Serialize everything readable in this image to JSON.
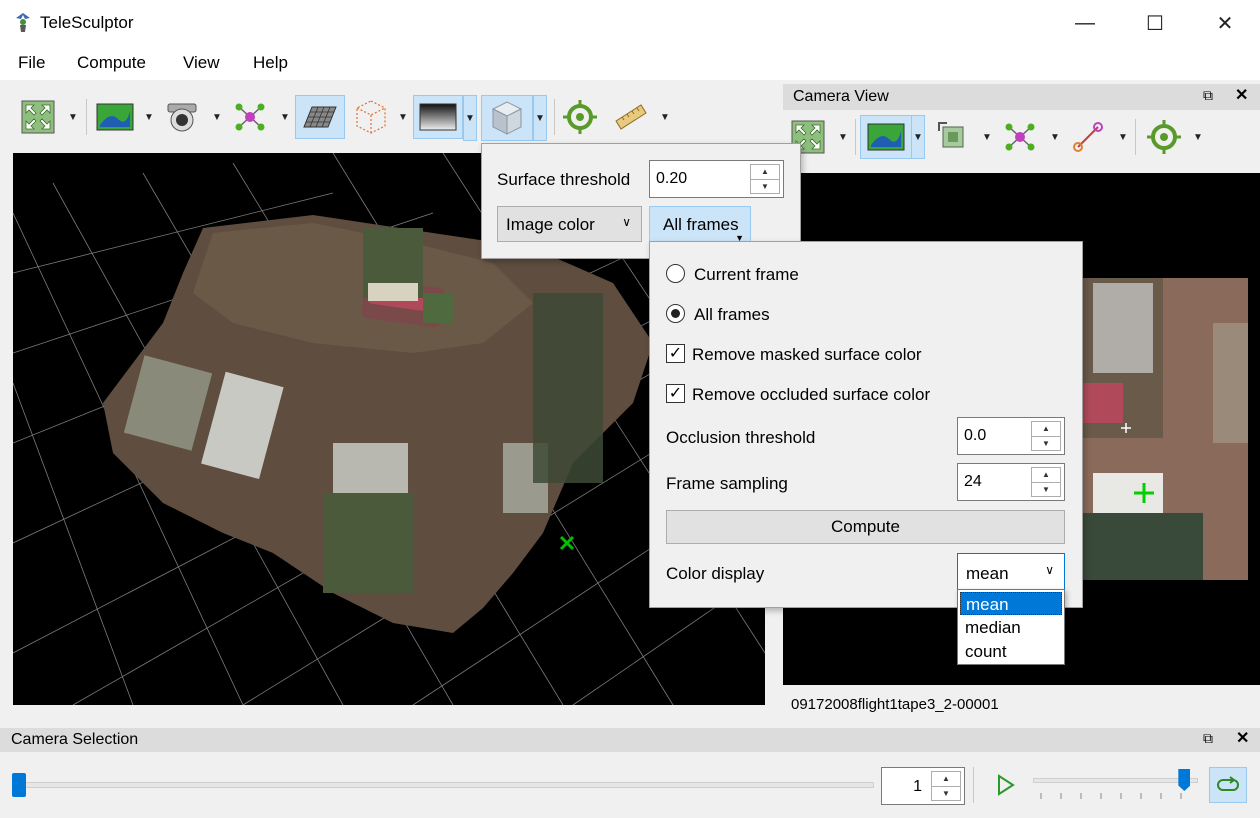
{
  "app": {
    "title": "TeleSculptor",
    "window_buttons": {
      "minimize": "—",
      "maximize": "☐",
      "close": "✕"
    }
  },
  "menu": [
    "File",
    "Compute",
    "View",
    "Help"
  ],
  "main_toolbar": {
    "buttons": [
      "reset-view-icon",
      "imagery-icon",
      "camera-icon",
      "landmarks-icon",
      "ground-plane-icon",
      "roi-box-icon",
      "depth-map-icon",
      "surface-icon",
      "world-point-icon",
      "ruler-icon"
    ],
    "active": [
      "ground-plane-icon",
      "depth-map-icon",
      "surface-icon"
    ]
  },
  "camera_view": {
    "title": "Camera View",
    "toolbar_buttons": [
      "reset-view-icon",
      "imagery-icon",
      "crop-icon",
      "landmarks-icon",
      "residuals-icon",
      "world-point-icon"
    ],
    "frame_name": "09172008flight1tape3_2-00001"
  },
  "surface_popup": {
    "threshold_label": "Surface threshold",
    "threshold_value": "0.20",
    "color_mode": "Image color",
    "frames_button": "All frames"
  },
  "color_popup": {
    "current_frame": "Current frame",
    "all_frames": "All frames",
    "remove_masked": "Remove masked surface color",
    "remove_occluded": "Remove occluded surface color",
    "occlusion_label": "Occlusion threshold",
    "occlusion_value": "0.0",
    "sampling_label": "Frame sampling",
    "sampling_value": "24",
    "compute_label": "Compute",
    "color_display_label": "Color display",
    "color_display_value": "mean",
    "color_display_options": [
      "mean",
      "median",
      "count"
    ],
    "selected_radio": "all_frames",
    "remove_masked_checked": true,
    "remove_occluded_checked": true
  },
  "camera_selection": {
    "title": "Camera Selection",
    "frame_value": "1",
    "slider_fraction": 0.0,
    "speed_fraction": 0.95
  },
  "colors": {
    "accent": "#0078d7",
    "active_button": "#cce4f7",
    "selected_option": "#0078d7"
  }
}
